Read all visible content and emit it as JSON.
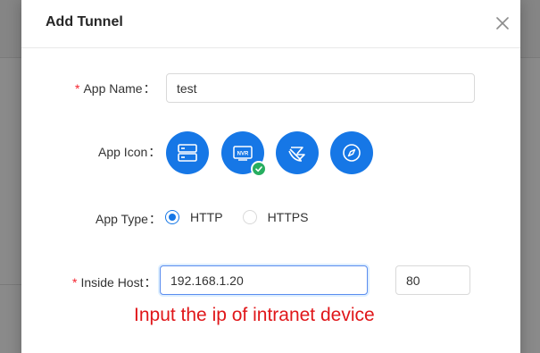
{
  "modal": {
    "title": "Add Tunnel",
    "close_icon": "close-icon"
  },
  "form": {
    "app_name": {
      "label": "App Name",
      "required": "*",
      "value": "test"
    },
    "app_icon": {
      "label": "App Icon",
      "icons": [
        "server-icon",
        "nvr-icon",
        "satellite-dish-icon",
        "compass-icon"
      ],
      "selected_index": 1
    },
    "app_type": {
      "label": "App Type",
      "options": [
        "HTTP",
        "HTTPS"
      ],
      "selected": "HTTP"
    },
    "inside_host": {
      "label": "Inside Host",
      "required": "*",
      "value": "192.168.1.20",
      "port": "80"
    },
    "colon": "："
  },
  "annotation": {
    "text": "Input the ip of intranet device",
    "color": "#e0171a"
  },
  "colors": {
    "primary": "#1677e6",
    "success": "#27ae60",
    "required": "#f5222d"
  }
}
